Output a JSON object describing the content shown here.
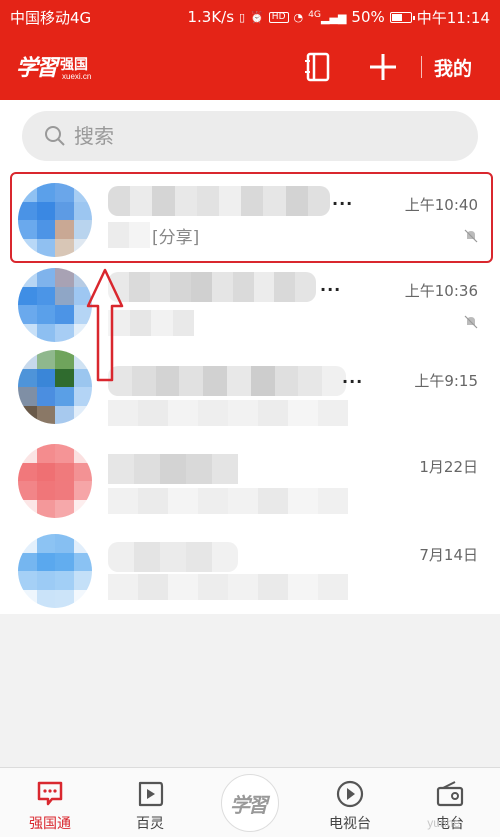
{
  "status_bar": {
    "carrier": "中国移动4G",
    "speed": "1.3K/s",
    "hd": "HD",
    "signal_label": "4G",
    "battery": "50%",
    "clock": "中午11:14"
  },
  "app_bar": {
    "logo_script": "学習",
    "logo_brand": "强国",
    "logo_domain": "xuexi.cn",
    "mine_label": "我的"
  },
  "search": {
    "placeholder": "搜索"
  },
  "chats": [
    {
      "time": "上午10:40",
      "preview_tag": "[分享]",
      "muted": true,
      "dots": "..."
    },
    {
      "time": "上午10:36",
      "muted": true,
      "dots": "..."
    },
    {
      "time": "上午9:15",
      "muted": false,
      "dots": "..."
    },
    {
      "time": "1月22日",
      "muted": false
    },
    {
      "time": "7月14日",
      "muted": false
    }
  ],
  "bottom_nav": {
    "tabs": [
      {
        "label": "强国通",
        "icon": "chat-bubble-icon",
        "active": true
      },
      {
        "label": "百灵",
        "icon": "video-play-icon",
        "active": false
      },
      {
        "label": "",
        "icon": "xuexi-logo-icon",
        "active": false
      },
      {
        "label": "电视台",
        "icon": "tv-play-icon",
        "active": false
      },
      {
        "label": "电台",
        "icon": "radio-icon",
        "active": false
      }
    ],
    "center_logo": "学習",
    "watermark": "yunhe"
  },
  "colors": {
    "brand_red": "#e42417",
    "highlight_red": "#d9272e"
  }
}
